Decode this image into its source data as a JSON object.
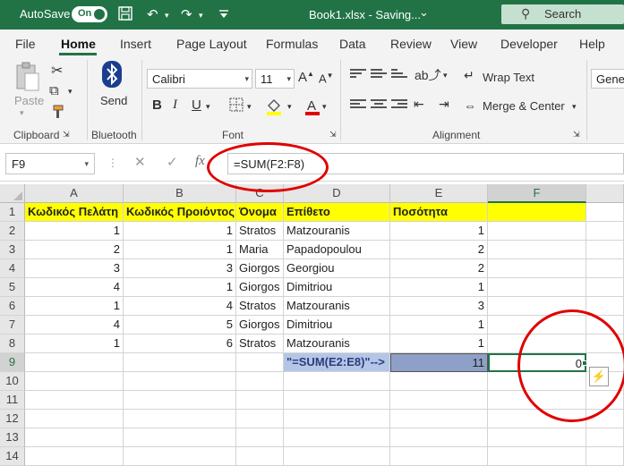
{
  "titlebar": {
    "autosave_label": "AutoSave",
    "toggle_label": "On",
    "filename": "Book1.xlsx - Saving...",
    "search_label": "Search"
  },
  "menu": {
    "items": [
      "File",
      "Home",
      "Insert",
      "Page Layout",
      "Formulas",
      "Data",
      "Review",
      "View",
      "Developer",
      "Help"
    ],
    "active": "Home"
  },
  "ribbon": {
    "paste_label": "Paste",
    "send_label": "Send",
    "font_name": "Calibri",
    "font_size": "11",
    "wrap_text": "Wrap Text",
    "merge_center": "Merge & Center",
    "number_format": "Gener",
    "groups": {
      "clipboard": "Clipboard",
      "bluetooth": "Bluetooth",
      "font": "Font",
      "alignment": "Alignment"
    }
  },
  "formula_bar": {
    "name_box": "F9",
    "formula": "=SUM(F2:F8)"
  },
  "sheet": {
    "columns": [
      "A",
      "B",
      "C",
      "D",
      "E",
      "F"
    ],
    "rows": [
      "1",
      "2",
      "3",
      "4",
      "5",
      "6",
      "7",
      "8",
      "9",
      "10",
      "11",
      "12",
      "13",
      "14"
    ],
    "header": [
      "Κωδικός Πελάτη",
      "Κωδικός Προιόντος",
      "Όνομα",
      "Επίθετο",
      "Ποσότητα",
      ""
    ],
    "data": [
      [
        "1",
        "1",
        "Stratos",
        "Matzouranis",
        "1",
        ""
      ],
      [
        "2",
        "1",
        "Maria",
        "Papadopoulou",
        "2",
        ""
      ],
      [
        "3",
        "3",
        "Giorgos",
        "Georgiou",
        "2",
        ""
      ],
      [
        "4",
        "1",
        "Giorgos",
        "Dimitriou",
        "1",
        ""
      ],
      [
        "1",
        "4",
        "Stratos",
        "Matzouranis",
        "3",
        ""
      ],
      [
        "4",
        "5",
        "Giorgos",
        "Dimitriou",
        "1",
        ""
      ],
      [
        "1",
        "6",
        "Stratos",
        "Matzouranis",
        "1",
        ""
      ]
    ],
    "row9": {
      "d": "\"=SUM(E2:E8)\"-->",
      "e": "11",
      "f": "0"
    }
  },
  "colors": {
    "excel_green": "#217346",
    "header_yellow": "#ffff00",
    "annotation_red": "#e00000"
  }
}
